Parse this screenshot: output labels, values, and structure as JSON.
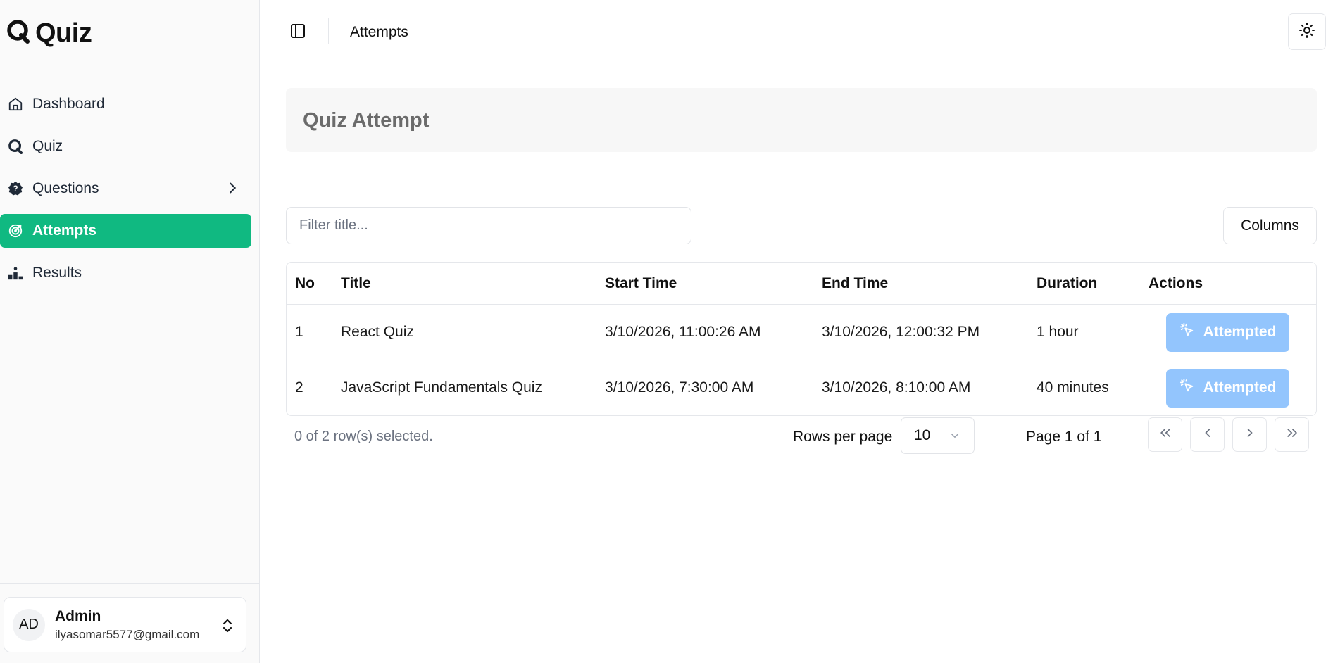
{
  "app": {
    "name": "Quiz"
  },
  "sidebar": {
    "items": [
      {
        "label": "Dashboard",
        "icon": "home-icon"
      },
      {
        "label": "Quiz",
        "icon": "quiz-logo-icon"
      },
      {
        "label": "Questions",
        "icon": "question-badge-icon"
      },
      {
        "label": "Attempts",
        "icon": "target-icon",
        "active": true
      },
      {
        "label": "Results",
        "icon": "podium-icon"
      }
    ],
    "user": {
      "initials": "AD",
      "name": "Admin",
      "email": "ilyasomar5577@gmail.com"
    }
  },
  "header": {
    "title": "Attempts"
  },
  "main": {
    "page_title": "Quiz Attempt",
    "filter": {
      "placeholder": "Filter title...",
      "value": ""
    },
    "columns_button": "Columns",
    "table": {
      "headers": [
        "No",
        "Title",
        "Start Time",
        "End Time",
        "Duration",
        "Actions"
      ],
      "rows": [
        {
          "no": "1",
          "title": "React Quiz",
          "start": "3/10/2026, 11:00:26 AM",
          "end": "3/10/2026, 12:00:32 PM",
          "duration": "1 hour",
          "action": "Attempted"
        },
        {
          "no": "2",
          "title": "JavaScript Fundamentals Quiz",
          "start": "3/10/2026, 7:30:00 AM",
          "end": "3/10/2026, 8:10:00 AM",
          "duration": "40 minutes",
          "action": "Attempted"
        }
      ]
    },
    "footer": {
      "selected": "0 of 2 row(s) selected.",
      "rows_per_page_label": "Rows per page",
      "rows_per_page_value": "10",
      "page_info": "Page 1 of 1"
    }
  },
  "colors": {
    "accent": "#10b981",
    "attempted_button": "#93c5fd"
  }
}
